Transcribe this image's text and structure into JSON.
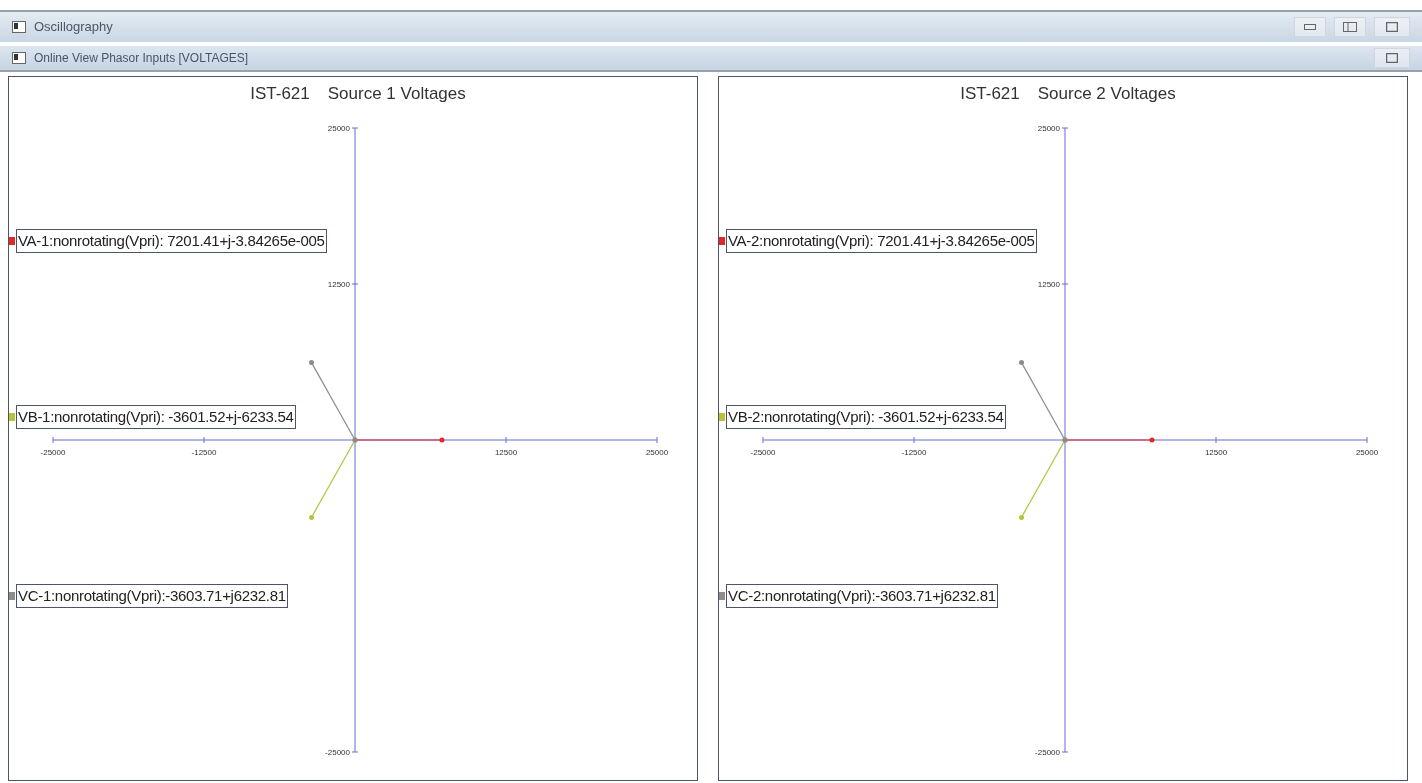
{
  "window": {
    "title": "Oscillography"
  },
  "subwindow": {
    "title": "Online View Phasor Inputs [VOLTAGES]"
  },
  "panels": [
    {
      "device": "IST-621",
      "title": "Source 1 Voltages",
      "chart_data": {
        "type": "line",
        "legend": "left",
        "xlim": [
          -25000,
          25000
        ],
        "ylim": [
          -25000,
          25000
        ],
        "xticks": [
          -25000,
          -12500,
          12500,
          25000
        ],
        "yticks": [
          -25000,
          12500,
          25000
        ],
        "x": [
          -3600,
          -3600,
          0,
          7200
        ],
        "series": [
          {
            "name": "VA-1:nonrotating(Vpri): 7201.41+j-3.84265e-005",
            "color": "#e02828",
            "values": [
              null,
              null,
              0,
              0
            ]
          },
          {
            "name": "VB-1:nonrotating(Vpri): -3601.52+j-6233.54",
            "color": "#b5c43c",
            "values": [
              null,
              -6200,
              0,
              null
            ]
          },
          {
            "name": "VC-1:nonrotating(Vpri):-3603.71+j6232.81",
            "color": "#8c8c8c",
            "values": [
              6200,
              null,
              0,
              null
            ]
          }
        ]
      }
    },
    {
      "device": "IST-621",
      "title": "Source 2 Voltages",
      "chart_data": {
        "type": "line",
        "legend": "left",
        "xlim": [
          -25000,
          25000
        ],
        "ylim": [
          -25000,
          25000
        ],
        "xticks": [
          -25000,
          -12500,
          12500,
          25000
        ],
        "yticks": [
          -25000,
          12500,
          25000
        ],
        "x": [
          -3600,
          -3600,
          0,
          7200
        ],
        "series": [
          {
            "name": "VA-2:nonrotating(Vpri): 7201.41+j-3.84265e-005",
            "color": "#e02828",
            "values": [
              null,
              null,
              0,
              0
            ]
          },
          {
            "name": "VB-2:nonrotating(Vpri): -3601.52+j-6233.54",
            "color": "#b5c43c",
            "values": [
              null,
              -6200,
              0,
              null
            ]
          },
          {
            "name": "VC-2:nonrotating(Vpri):-3603.71+j6232.81",
            "color": "#8c8c8c",
            "values": [
              6200,
              null,
              0,
              null
            ]
          }
        ]
      }
    }
  ]
}
